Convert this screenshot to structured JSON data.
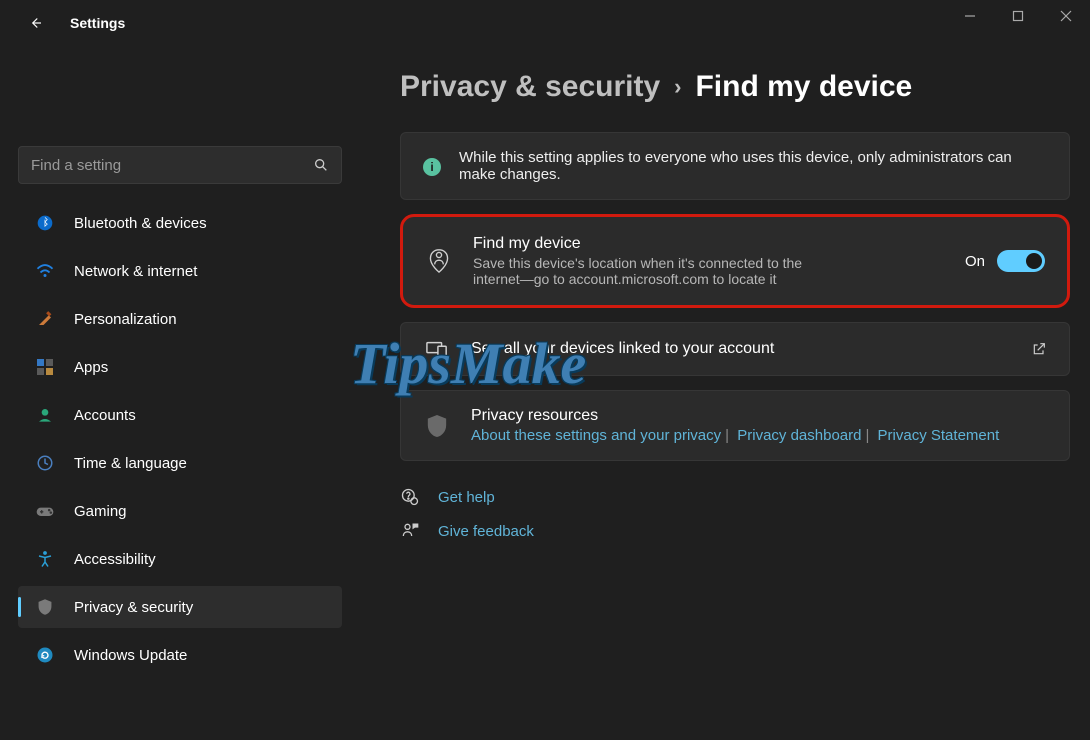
{
  "header": {
    "title": "Settings"
  },
  "search": {
    "placeholder": "Find a setting"
  },
  "sidebar": {
    "items": [
      {
        "label": "Bluetooth & devices"
      },
      {
        "label": "Network & internet"
      },
      {
        "label": "Personalization"
      },
      {
        "label": "Apps"
      },
      {
        "label": "Accounts"
      },
      {
        "label": "Time & language"
      },
      {
        "label": "Gaming"
      },
      {
        "label": "Accessibility"
      },
      {
        "label": "Privacy & security"
      },
      {
        "label": "Windows Update"
      }
    ]
  },
  "breadcrumb": {
    "parent": "Privacy & security",
    "current": "Find my device"
  },
  "info_banner": {
    "text": "While this setting applies to everyone who uses this device, only administrators can make changes."
  },
  "find_my_device": {
    "title": "Find my device",
    "description": "Save this device's location when it's connected to the internet—go to account.microsoft.com to locate it",
    "state_label": "On"
  },
  "linked_devices": {
    "label": "See all your devices linked to your account"
  },
  "privacy_resources": {
    "title": "Privacy resources",
    "links": [
      "About these settings and your privacy",
      "Privacy dashboard",
      "Privacy Statement"
    ]
  },
  "footer": {
    "help": "Get help",
    "feedback": "Give feedback"
  }
}
